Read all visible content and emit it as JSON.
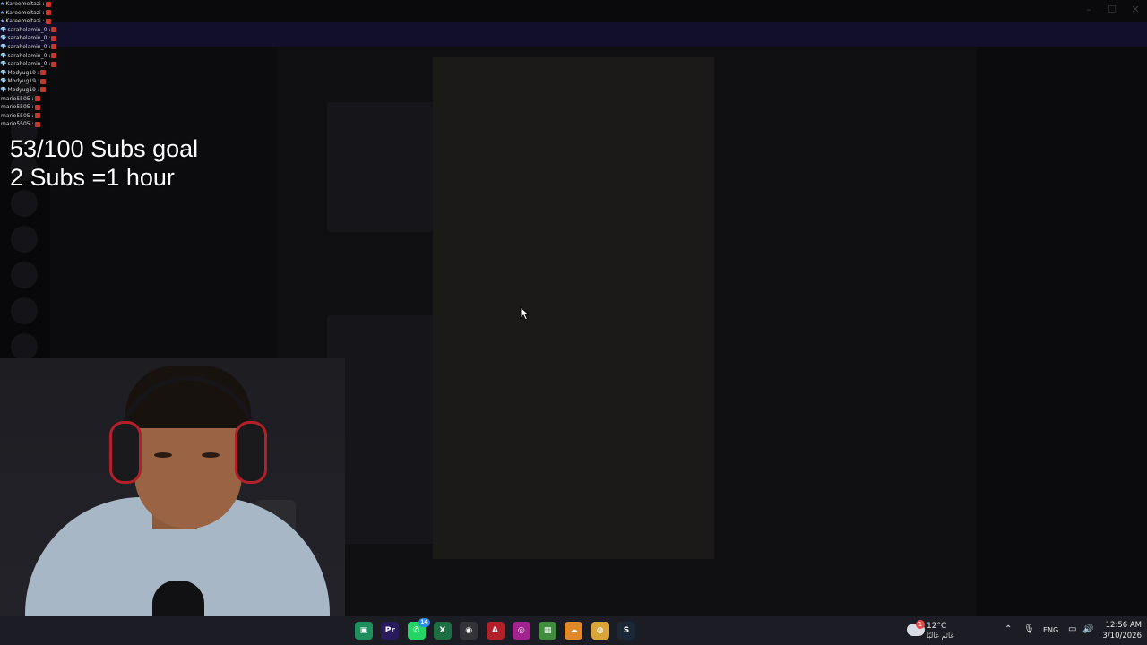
{
  "stream_overlay": {
    "chat_lines": [
      {
        "user": "Kareemeltazi",
        "prefix": "★"
      },
      {
        "user": "Kareemeltazi",
        "prefix": "★"
      },
      {
        "user": "Kareemeltazi",
        "prefix": "★"
      },
      {
        "user": "sarahelamin_0",
        "prefix": "💎"
      },
      {
        "user": "sarahelamin_0",
        "prefix": "💎"
      },
      {
        "user": "sarahelamin_0",
        "prefix": "💎"
      },
      {
        "user": "sarahelamin_0",
        "prefix": "💎"
      },
      {
        "user": "sarahelamin_0",
        "prefix": "💎"
      },
      {
        "user": "Modyug19",
        "prefix": "💎"
      },
      {
        "user": "Modyug19",
        "prefix": "💎"
      },
      {
        "user": "Modyug19",
        "prefix": "💎"
      },
      {
        "user": "mario5505",
        "prefix": ""
      },
      {
        "user": "mario5505",
        "prefix": ""
      },
      {
        "user": "mario5505",
        "prefix": ""
      },
      {
        "user": "mario5505",
        "prefix": ""
      }
    ],
    "goal_line1": "53/100 Subs goal",
    "goal_line2": "2 Subs =1 hour"
  },
  "taskbar": {
    "icons": [
      {
        "name": "app-icon",
        "label": "▣",
        "color": "#1f8f5f"
      },
      {
        "name": "premiere-icon",
        "label": "Pr",
        "color": "#2a1a5e"
      },
      {
        "name": "whatsapp-icon",
        "label": "✆",
        "color": "#25d366",
        "badge": "14"
      },
      {
        "name": "excel-icon",
        "label": "X",
        "color": "#1d6f42"
      },
      {
        "name": "obs-icon",
        "label": "◉",
        "color": "#333338"
      },
      {
        "name": "acrobat-icon",
        "label": "A",
        "color": "#b3202a"
      },
      {
        "name": "pink-app-icon",
        "label": "◎",
        "color": "#a2238f"
      },
      {
        "name": "minecraft-icon",
        "label": "▦",
        "color": "#3e8e3e"
      },
      {
        "name": "cloud-app-icon",
        "label": "☁",
        "color": "#e0882a"
      },
      {
        "name": "chrome-icon",
        "label": "◍",
        "color": "#d9a43a"
      },
      {
        "name": "steam-icon",
        "label": "S",
        "color": "#1b2838"
      }
    ],
    "weather": {
      "temp": "12°C",
      "condition": "غائم غالبًا",
      "alert": "1"
    },
    "language": "ENG",
    "time": "12:56 AM",
    "date": "3/10/2026"
  }
}
